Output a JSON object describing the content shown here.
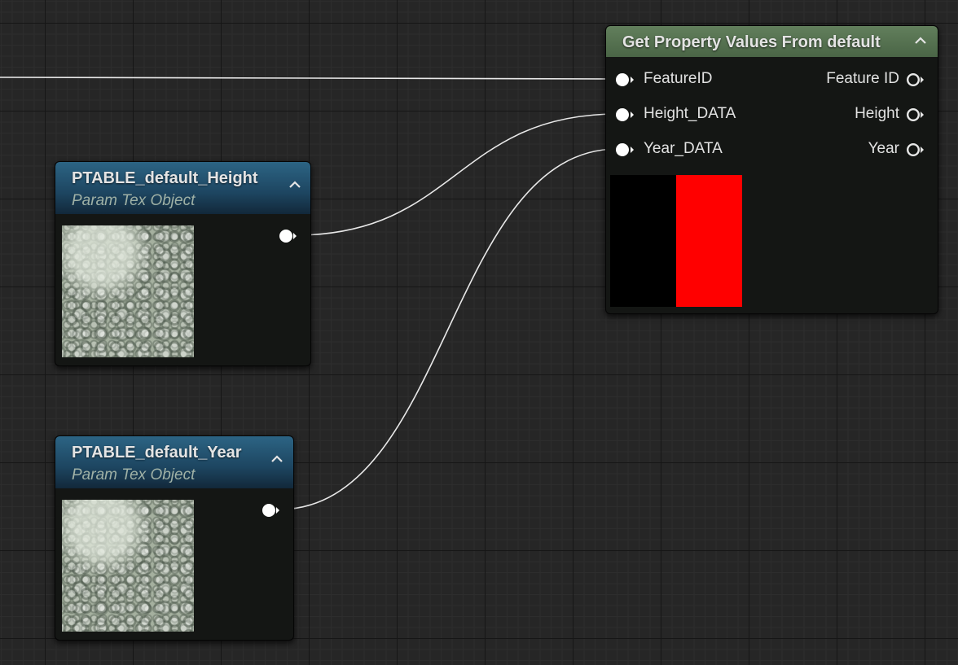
{
  "nodes": {
    "height_param": {
      "title": "PTABLE_default_Height",
      "subtitle": "Param Tex Object",
      "thumbnail_icon": "moon-crater-texture"
    },
    "year_param": {
      "title": "PTABLE_default_Year",
      "subtitle": "Param Tex Object",
      "thumbnail_icon": "moon-crater-texture"
    },
    "get_property": {
      "title": "Get Property Values From default",
      "inputs": [
        "FeatureID",
        "Height_DATA",
        "Year_DATA"
      ],
      "outputs": [
        "Feature ID",
        "Height",
        "Year"
      ],
      "preview_colors": [
        "#000000",
        "#ff0000"
      ]
    }
  },
  "colors": {
    "graph_background": "#262626",
    "param_header": "#2c6484",
    "function_header": "#627f5c",
    "wire": "#e8e8e8",
    "pin": "#ffffff"
  }
}
